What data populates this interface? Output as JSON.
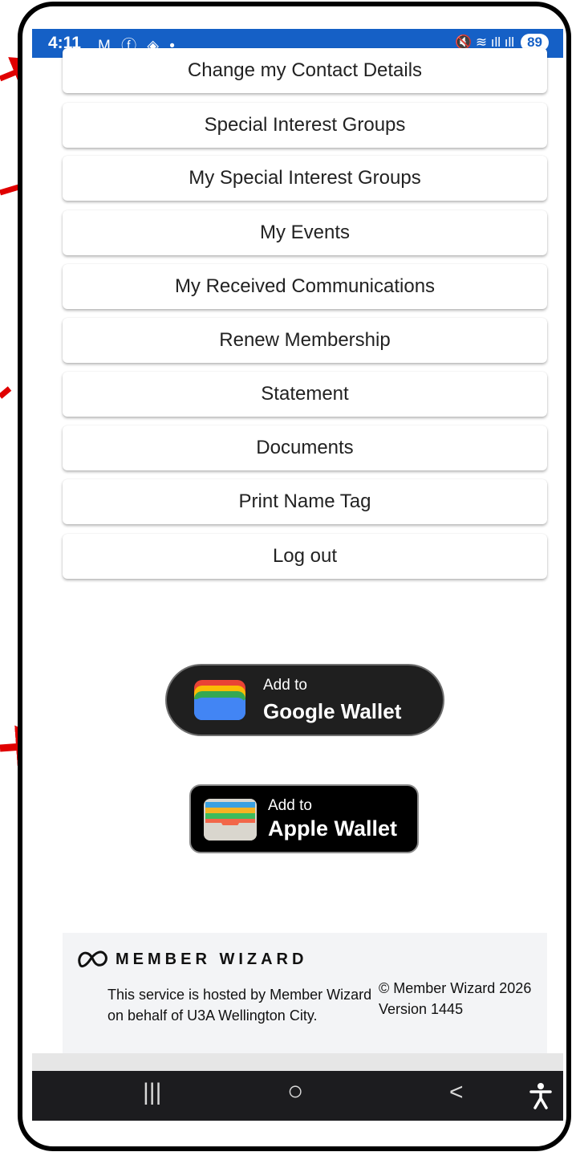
{
  "status_bar": {
    "time": "4:11",
    "left_icons": "M ⓕ ◈ •",
    "right_icons": "🔇 ≋ ıll ıll",
    "battery": "89"
  },
  "menu_items": [
    "Change my Contact Details",
    "Special Interest Groups",
    "My Special Interest Groups",
    "My Events",
    "My Received Communications",
    "Renew Membership",
    "Statement",
    "Documents",
    "Print Name Tag",
    "Log out"
  ],
  "google_wallet": {
    "line1": "Add to",
    "line2": "Google Wallet"
  },
  "apple_wallet": {
    "line1": "Add to",
    "line2": "Apple Wallet"
  },
  "footer": {
    "logo_text": "MEMBER WIZARD",
    "hosted_text": "This service is hosted by Member Wizard on behalf of U3A Wellington City.",
    "copyright": "© Member Wizard 2026 Version 1445"
  },
  "nav": {
    "recents": "|||",
    "home": "○",
    "back": "<"
  },
  "colors": {
    "status_bar": "#1560c6",
    "nav_bar": "#1c1c1f",
    "arrow": "#e00000"
  }
}
